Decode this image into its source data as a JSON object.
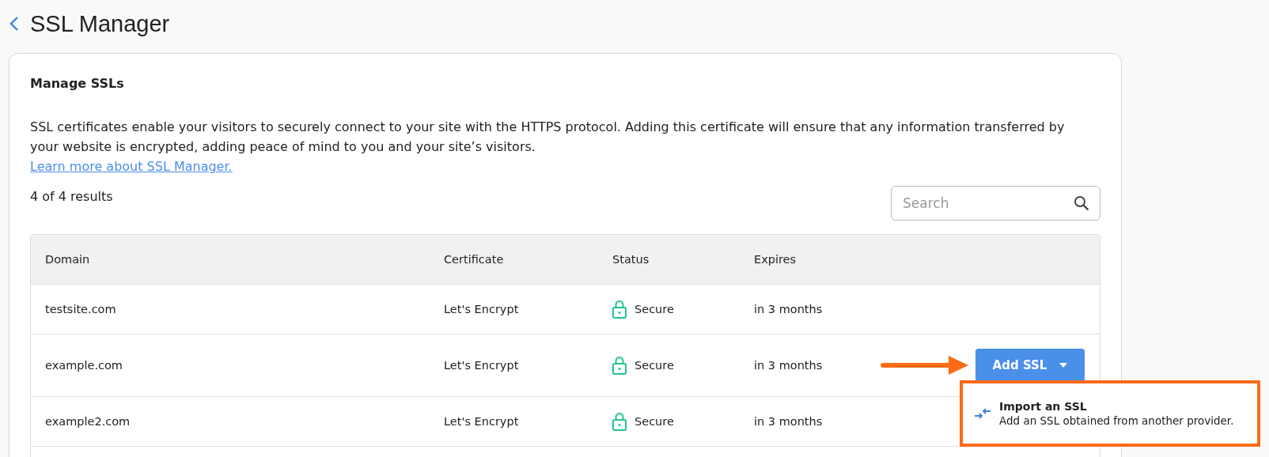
{
  "page": {
    "title": "SSL Manager"
  },
  "card": {
    "heading": "Manage SSLs",
    "description": "SSL certificates enable your visitors to securely connect to your site with the HTTPS protocol. Adding this certificate will ensure that any information transferred by your website is encrypted, adding peace of mind to you and your site’s visitors.",
    "link": "Learn more about SSL Manager.",
    "results": "4 of 4 results"
  },
  "search": {
    "placeholder": "Search"
  },
  "table": {
    "columns": [
      "Domain",
      "Certificate",
      "Status",
      "Expires"
    ],
    "rows": [
      {
        "domain": "testsite.com",
        "certificate": "Let's Encrypt",
        "status": "Secure",
        "expires": "in 3 months"
      },
      {
        "domain": "example.com",
        "certificate": "Let's Encrypt",
        "status": "Secure",
        "expires": "in 3 months",
        "button": "Add SSL",
        "menu": [
          {
            "title": "Import an SSL",
            "description": "Add an SSL obtained from another provider."
          }
        ]
      },
      {
        "domain": "example2.com",
        "certificate": "Let's Encrypt",
        "status": "Secure",
        "expires": "in 3 months"
      }
    ]
  }
}
